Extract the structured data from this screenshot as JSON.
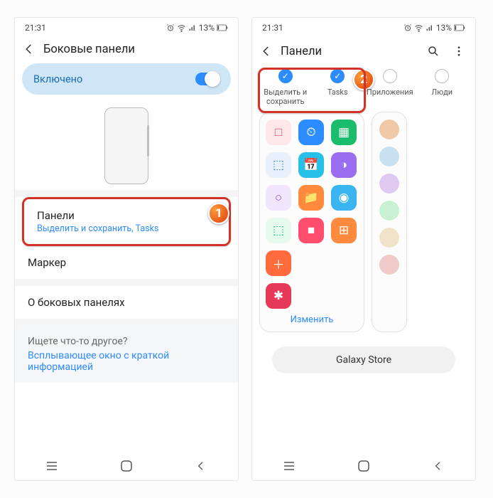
{
  "status": {
    "time": "21:31",
    "battery": "13%"
  },
  "screen1": {
    "title": "Боковые панели",
    "enabled_label": "Включено",
    "rows": {
      "panels_title": "Панели",
      "panels_sub": "Выделить и сохранить, Tasks",
      "marker": "Маркер",
      "about": "О боковых панелях",
      "other_heading": "Ищете что-то другое?",
      "popup": "Всплывающее окно с краткой информацией"
    },
    "badge": "1"
  },
  "screen2": {
    "title": "Панели",
    "badge": "2",
    "tabs": [
      {
        "label": "Выделить и сохранить",
        "checked": true
      },
      {
        "label": "Tasks",
        "checked": true
      },
      {
        "label": "Приложения",
        "checked": false
      },
      {
        "label": "Люди",
        "checked": false
      }
    ],
    "edit_label": "Изменить",
    "store_label": "Galaxy Store",
    "panel_icons": [
      {
        "bg": "#fde7e8",
        "fg": "#e84a5f",
        "glyph": "□"
      },
      {
        "bg": "#2d8cff",
        "fg": "#fff",
        "glyph": "⏲"
      },
      {
        "bg": "#1bbc6b",
        "fg": "#fff",
        "glyph": "▦"
      },
      {
        "bg": "#e8f0fb",
        "fg": "#3a7bd5",
        "glyph": "⬚"
      },
      {
        "bg": "#29c0e7",
        "fg": "#fff",
        "glyph": "📅"
      },
      {
        "bg": "#9a6cf0",
        "fg": "#fff",
        "glyph": "◑"
      },
      {
        "bg": "#f2e6ff",
        "fg": "#8a4bd8",
        "glyph": "○"
      },
      {
        "bg": "#ff8a3d",
        "fg": "#fff",
        "glyph": "📁"
      },
      {
        "bg": "#3bb4f2",
        "fg": "#fff",
        "glyph": "◉"
      },
      {
        "bg": "#e6fbef",
        "fg": "#1bbc6b",
        "glyph": "⬚"
      },
      {
        "bg": "#ff4d6d",
        "fg": "#fff",
        "glyph": "■"
      },
      {
        "bg": "#ff8a3d",
        "fg": "#fff",
        "glyph": "⊞"
      },
      {
        "bg": "#ff6b3d",
        "fg": "#fff",
        "glyph": "＋"
      },
      {
        "bg": "#e6395a",
        "fg": "#fff",
        "glyph": "✱"
      }
    ],
    "avatars": [
      "#f0c9a8",
      "#c9e0f0",
      "#e0c9f0",
      "#c9f0d3",
      "#f0e3c9",
      "#f0c9c9"
    ]
  }
}
